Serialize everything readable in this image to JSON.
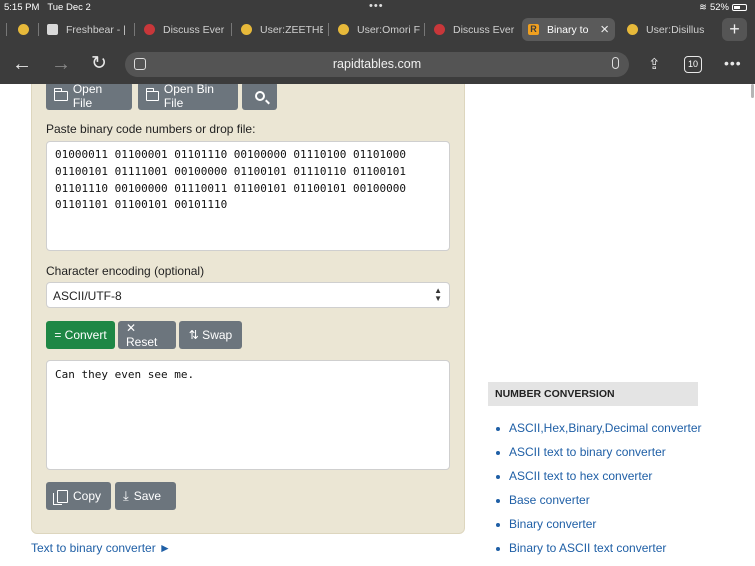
{
  "status_bar": {
    "time": "5:15 PM",
    "date": "Tue Dec 2",
    "dots": "•••",
    "battery_pct": "52%"
  },
  "tabs": [
    {
      "label": "",
      "favicon_color": "#e7b93a"
    },
    {
      "label": "Freshbear - |",
      "favicon_color": "#d9d9d9"
    },
    {
      "label": "Discuss Ever",
      "favicon_color": "#c8373a"
    },
    {
      "label": "User:ZEETHE",
      "favicon_color": "#e7b93a"
    },
    {
      "label": "User:Omori F",
      "favicon_color": "#e7b93a"
    },
    {
      "label": "Discuss Ever",
      "favicon_color": "#c8373a"
    },
    {
      "label": "Binary to",
      "favicon_color": "#f0a020",
      "active": true
    },
    {
      "label": "User:Disillus",
      "favicon_color": "#e7b93a"
    }
  ],
  "tab_count": "10",
  "url": "rapidtables.com",
  "toolbar": {
    "open_file": "Open File",
    "open_bin_file": "Open Bin File"
  },
  "input": {
    "label": "Paste binary code numbers or drop file:",
    "value": "01000011 01100001 01101110 00100000 01110100 01101000\n01100101 01111001 00100000 01100101 01110110 01100101\n01101110 00100000 01110011 01100101 01100101 00100000\n01101101 01100101 00101110"
  },
  "encoding": {
    "label": "Character encoding (optional)",
    "selected": "ASCII/UTF-8"
  },
  "actions": {
    "convert": "= Convert",
    "reset": "✕ Reset",
    "swap": "⇅ Swap"
  },
  "output": {
    "value": "Can they even see me."
  },
  "output_actions": {
    "copy": "Copy",
    "save": "Save"
  },
  "bottom_link": "Text to binary converter ►",
  "sidebar": {
    "heading": "NUMBER CONVERSION",
    "items": [
      "ASCII,Hex,Binary,Decimal converter",
      "ASCII text to binary converter",
      "ASCII text to hex converter",
      "Base converter",
      "Binary converter",
      "Binary to ASCII text converter"
    ]
  },
  "colors": {
    "browser_chrome": "#3c3c3c",
    "panel_bg": "#ebe6d4",
    "button_gray": "#6c757d",
    "button_green": "#1e8745",
    "link": "#1f5fa6"
  }
}
